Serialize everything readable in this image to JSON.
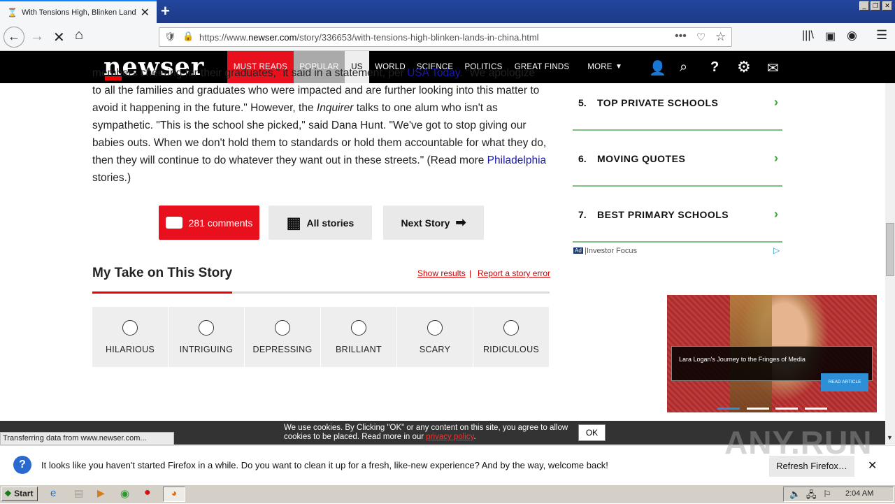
{
  "browser": {
    "tab_title": "With Tensions High, Blinken Lands",
    "url": "https://www.newser.com/story/336653/with-tensions-high-blinken-lands-in-china.html",
    "url_domain_prefix": "https://www.",
    "url_domain": "newser.com",
    "url_path": "/story/336653/with-tensions-high-blinken-lands-in-china.html",
    "status_text": "Transferring data from www.newser.com..."
  },
  "site": {
    "logo": "newser",
    "menu": [
      "MUST READS",
      "POPULAR",
      "US",
      "WORLD",
      "SCIENCE",
      "POLITICS",
      "GREAT FINDS",
      "MORE"
    ],
    "accent_color": "#e8101c"
  },
  "article": {
    "p1_a": "members cheering for their graduates,\" it said in a statement, per ",
    "p1_link": "USA Today",
    "p1_b": ". \"We apologize to all the families and graduates who were impacted and are further looking into this matter to avoid it happening in the future.\" However, the ",
    "p1_em": "Inquirer",
    "p1_c": " talks to one alum who isn't as sympathetic. \"This is the school she picked,\" said Dana Hunt. \"We've got to stop giving our babies outs. When we don't hold them to standards or hold them accountable for what they do, then they will continue to do whatever they want out in these streets.\" (Read more ",
    "p1_link2": "Philadelphia",
    "p1_d": " stories.)",
    "comments_label": "281 comments",
    "all_stories_label": "All stories",
    "next_story_label": "Next Story"
  },
  "my_take": {
    "title": "My Take on This Story",
    "show_results": "Show results",
    "separator": "|",
    "report_error": "Report a story error",
    "options": [
      "HILARIOUS",
      "INTRIGUING",
      "DEPRESSING",
      "BRILLIANT",
      "SCARY",
      "RIDICULOUS"
    ]
  },
  "sidebar": {
    "items": [
      {
        "num": "5.",
        "label": "TOP PRIVATE SCHOOLS"
      },
      {
        "num": "6.",
        "label": "MOVING QUOTES"
      },
      {
        "num": "7.",
        "label": "BEST PRIMARY SCHOOLS"
      }
    ],
    "ad_badge": "Ad",
    "ad_source": "Investor Focus"
  },
  "video_ad": {
    "caption": "Lara Logan's Journey to the Fringes of Media",
    "cta": "READ ARTICLE"
  },
  "cookie": {
    "text_a": "We use cookies. By Clicking \"OK\" or any content on this site, you agree to allow cookies to be placed. Read more in our ",
    "link": "privacy policy",
    "text_b": ".",
    "ok": "OK"
  },
  "notification": {
    "text": "It looks like you haven't started Firefox in a while. Do you want to clean it up for a fresh, like-new experience? And by the way, welcome back!",
    "button": "Refresh Firefox…"
  },
  "taskbar": {
    "start": "Start",
    "clock": "2:04 AM"
  },
  "watermark": "ANY.RUN"
}
